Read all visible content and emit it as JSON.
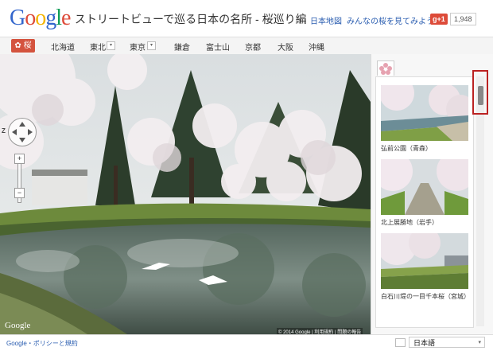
{
  "header": {
    "logo": [
      "G",
      "o",
      "o",
      "g",
      "l",
      "e"
    ],
    "logo_colors": [
      "#3366cc",
      "#dd4b39",
      "#f4b400",
      "#3366cc",
      "#0f9d58",
      "#dd4b39"
    ],
    "title": "ストリートビューで巡る日本の名所 - 桜巡り編",
    "link_map": "日本地図",
    "link_share": "みんなの桜を見てみよう。",
    "gplus_label": "g+1",
    "gplus_count": "1,948"
  },
  "nav": {
    "active_label": "✿ 桜",
    "items": [
      "北海道",
      "東北",
      "東京",
      "鎌倉",
      "富士山",
      "京都",
      "大阪",
      "沖縄"
    ],
    "dropdown_glyph": "▾"
  },
  "pano": {
    "nav_label": "Z",
    "zoom_in": "+",
    "zoom_out": "−",
    "google_mark": "Google",
    "credit": "© 2014 Google | 利用規約 | 問題の報告"
  },
  "sidebar": {
    "tab_icon": "sakura-icon",
    "spots": [
      {
        "label": "弘前公園（青森）"
      },
      {
        "label": "北上展勝地（岩手）"
      },
      {
        "label": "白石川堤の一目千本桜（宮城）"
      }
    ]
  },
  "footer": {
    "links": "Google・ポリシーと規約",
    "language": "日本語",
    "caret": "▾"
  },
  "colors": {
    "accent": "#d4533e",
    "link": "#2a5db0",
    "highlight": "#bb2222"
  }
}
